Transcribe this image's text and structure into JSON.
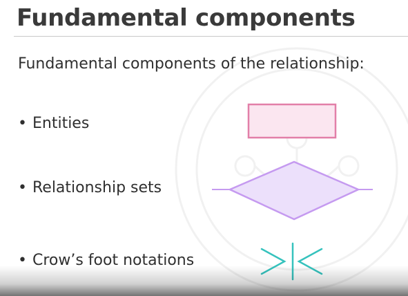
{
  "slide": {
    "title": "Fundamental components",
    "subtitle": "Fundamental components of the relationship:",
    "bullet_glyph": "•",
    "bullets": [
      {
        "label": "Entities",
        "symbol": "entity-rectangle"
      },
      {
        "label": "Relationship sets",
        "symbol": "relationship-diamond"
      },
      {
        "label": "Crow’s foot notations",
        "symbol": "crows-foot-notation"
      }
    ]
  },
  "colors": {
    "title_text": "#3a3a3a",
    "body_text": "#2f2f2f",
    "entity_stroke": "#e27fa8",
    "entity_fill": "#fbe6f0",
    "relationship_stroke": "#c59af0",
    "relationship_fill": "#ece0fb",
    "crows_foot_stroke": "#35c2bd"
  }
}
